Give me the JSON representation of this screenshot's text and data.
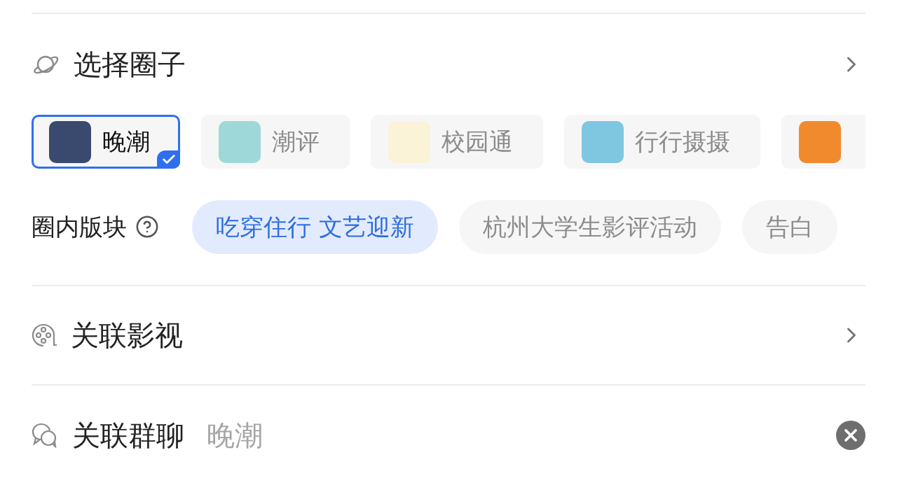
{
  "circle_section": {
    "title": "选择圈子",
    "circles": [
      {
        "name": "晚潮",
        "selected": true,
        "color": "#3a4a6e"
      },
      {
        "name": "潮评",
        "selected": false,
        "color": "#9fd8d8"
      },
      {
        "name": "校园通",
        "selected": false,
        "color": "#fbf3d8"
      },
      {
        "name": "行行摄摄",
        "selected": false,
        "color": "#7fc6e0"
      },
      {
        "selected": false,
        "color": "#f08a2c"
      }
    ]
  },
  "board_section": {
    "label": "圈内版块",
    "boards": [
      {
        "name": "吃穿住行 文艺迎新",
        "selected": true
      },
      {
        "name": "杭州大学生影评活动",
        "selected": false
      },
      {
        "name": "告白",
        "selected": false
      }
    ]
  },
  "film_row": {
    "title": "关联影视"
  },
  "group_chat_row": {
    "title": "关联群聊",
    "value": "晚潮"
  }
}
